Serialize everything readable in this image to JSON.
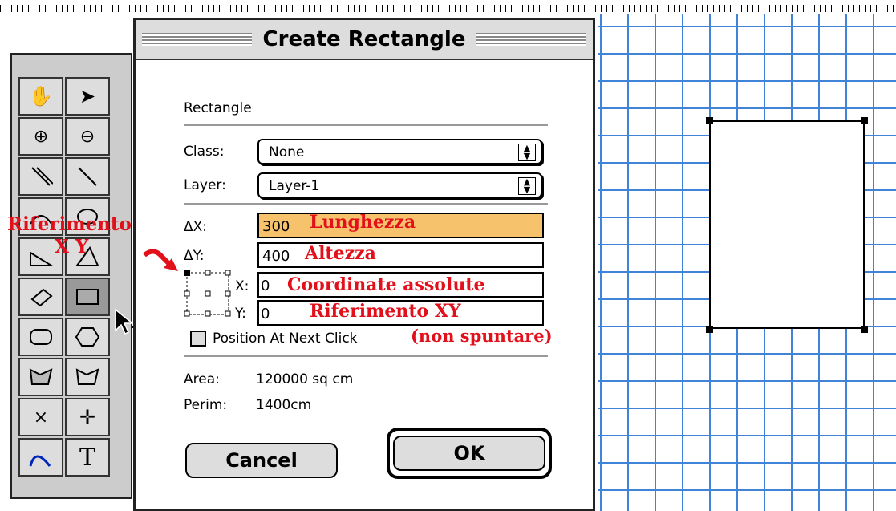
{
  "dialog": {
    "title": "Create Rectangle",
    "section": "Rectangle",
    "class_label": "Class:",
    "class_value": "None",
    "layer_label": "Layer:",
    "layer_value": "Layer-1",
    "dx_label": "ΔX:",
    "dx_value": "300",
    "dy_label": "ΔY:",
    "dy_value": "400",
    "x_label": "X:",
    "x_value": "0",
    "y_label": "Y:",
    "y_value": "0",
    "checkbox_label": "Position At Next Click",
    "area_label": "Area:",
    "area_value": "120000 sq cm",
    "perim_label": "Perim:",
    "perim_value": "1400cm",
    "cancel": "Cancel",
    "ok": "OK"
  },
  "annotations": {
    "riferimento": "Riferimento",
    "xy": "X Y",
    "lunghezza": "Lunghezza",
    "altezza": "Altezza",
    "coordinate": "Coordinate assolute",
    "riferimento_xy": "Riferimento XY",
    "non_spuntare": "(non spuntare)"
  },
  "toolbox": {
    "text_tool": "T",
    "x_tool": "×"
  },
  "colors": {
    "annotation": "#e2101a",
    "grid": "#3f84d8",
    "active_field": "#f6c26c"
  }
}
